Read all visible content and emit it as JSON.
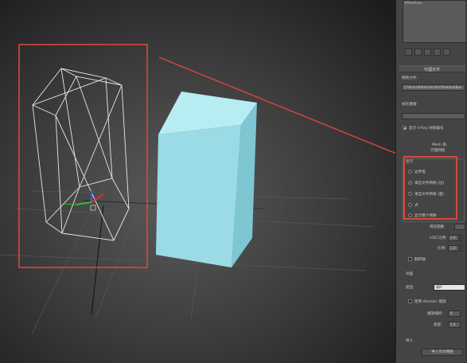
{
  "panel": {
    "preview_title": "#MaxProxy",
    "rollout_proxy_file": "代理文件",
    "path_label": "网格文件:",
    "path_value": "C:\\Users\\Administrator\\Desktop\\Boo",
    "frame_label": "帧的重播:",
    "frame_value": "",
    "show_materials_label": "显示 V-Ray 材质编号",
    "mesh_rollout_title": "Mesh 照",
    "display_rollout_title": "代理网格",
    "display_group_title": "显示",
    "display_options": [
      {
        "label": "边界框",
        "selected": false
      },
      {
        "label": "来自文件网格 (边)",
        "selected": true
      },
      {
        "label": "来自文件网格 (面)",
        "selected": false
      },
      {
        "label": "点",
        "selected": false
      },
      {
        "label": "显示整个网格",
        "selected": false
      }
    ],
    "preview_face_label": "预览面数",
    "lod_label": "LOD 比例:",
    "lod_value": "1.0",
    "scale_label": "比例:",
    "scale_value": "1.0",
    "flip_axis_label": "翻转轴",
    "anim_group_title": "动画",
    "anim_type_label": "类型:",
    "anim_type_value": "循环",
    "alembic_label": "使用 Alembic 播放",
    "offset_label": "播放偏移:",
    "offset_value": "0",
    "speed_label": "速度:",
    "speed_value": "1.0",
    "import_group_title": "导入",
    "import_button": "导入作为网格"
  }
}
